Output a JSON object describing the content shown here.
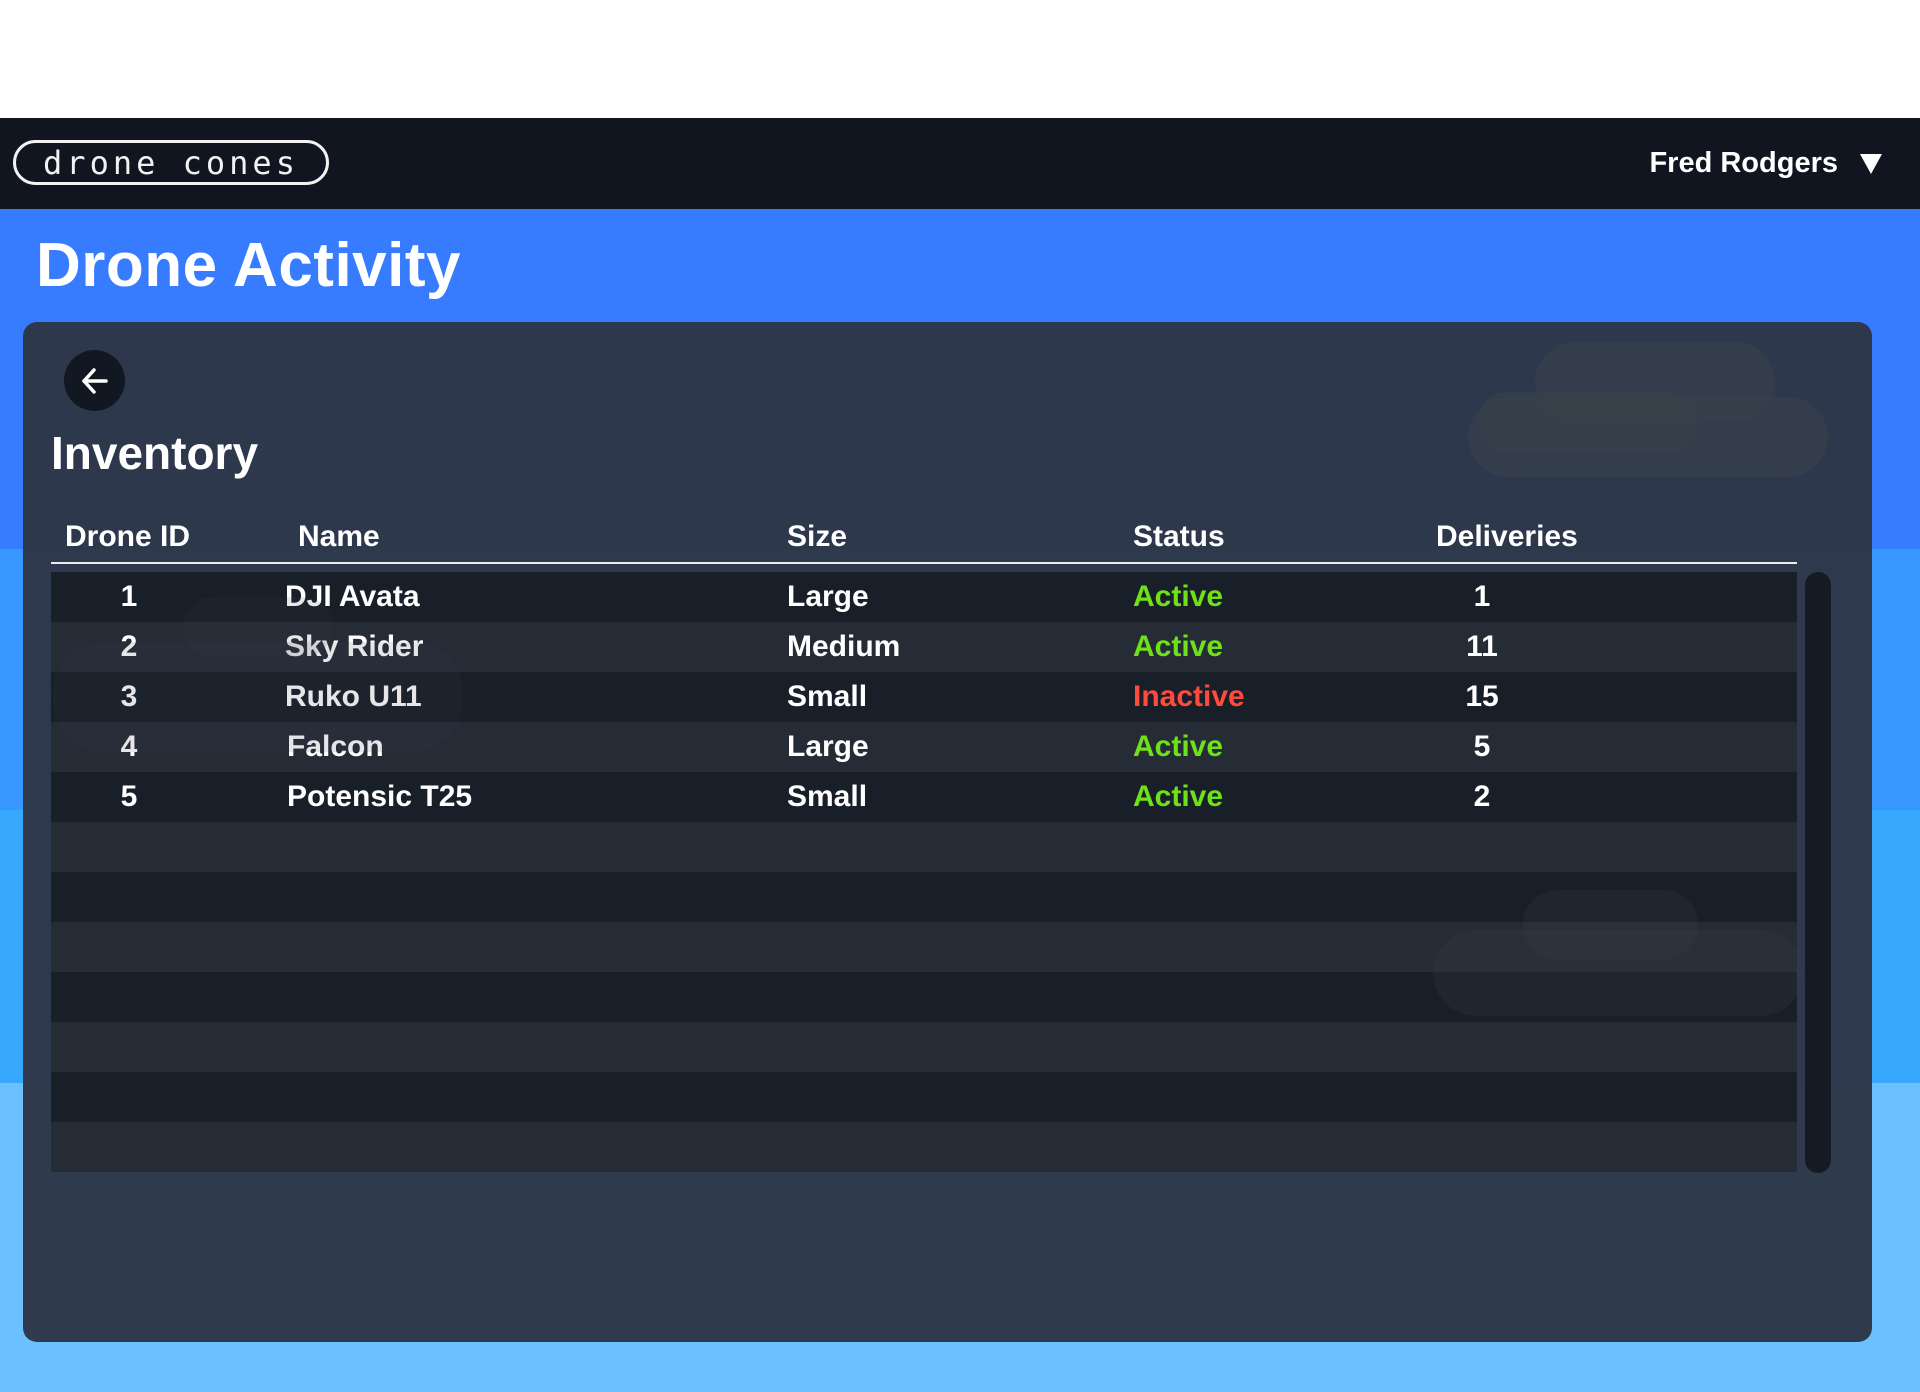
{
  "app": {
    "logo_text": "drone cones",
    "user_name": "Fred Rodgers"
  },
  "page": {
    "title": "Drone Activity",
    "section_title": "Inventory"
  },
  "colors": {
    "active": "#6fe01a",
    "inactive": "#ff4a3d"
  },
  "table": {
    "headers": [
      "Drone ID",
      "Name",
      "Size",
      "Status",
      "Deliveries"
    ],
    "rows": [
      {
        "id": "1",
        "name": "DJI Avata",
        "size": "Large",
        "status": "Active",
        "deliveries": "1"
      },
      {
        "id": "2",
        "name": "Sky Rider",
        "size": "Medium",
        "status": "Active",
        "deliveries": "11"
      },
      {
        "id": "3",
        "name": "Ruko U11",
        "size": "Small",
        "status": "Inactive",
        "deliveries": "15"
      },
      {
        "id": "4",
        "name": "Falcon",
        "size": "Large",
        "status": "Active",
        "deliveries": "5"
      },
      {
        "id": "5",
        "name": "Potensic T25",
        "size": "Small",
        "status": "Active",
        "deliveries": "2"
      }
    ]
  },
  "icons": {
    "back": "arrow-left-icon",
    "user_menu": "triangle-down-icon"
  }
}
